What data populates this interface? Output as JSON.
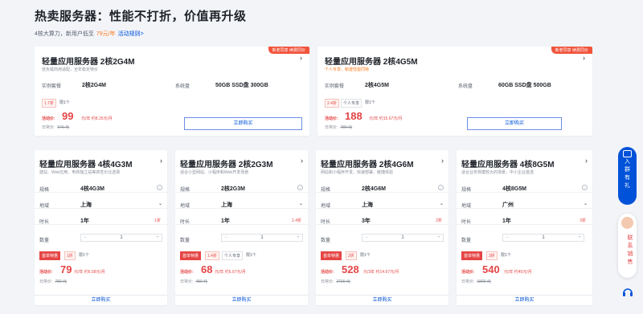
{
  "header": {
    "title": "热卖服务器：性能不打折，价值再升级",
    "sub_prefix": "4核大算力，新用户低至",
    "sub_price": "79元/年",
    "sub_link": "活动规则>"
  },
  "top_cards": [
    {
      "tag": "新老同享 续费同价",
      "title": "轻量应用服务器 2核2G4M",
      "desc": "低负载商用适配，全年稳定特价",
      "spec_label": "实例套餐",
      "spec_value": "2核2G4M",
      "disk_label": "系统盘",
      "disk_value": "50GB SSD盘 300GB",
      "disc": "1.7折",
      "qty": "限1个",
      "price_label": "活动价:",
      "price": "99",
      "unit": "元/年 约8.25元/月",
      "orig_label": "日常价:",
      "orig": "576 元",
      "buy": "立即购买"
    },
    {
      "tag": "新老同享 续费同价",
      "title": "轻量应用服务器 2核4G5M",
      "desc": "个人专享，新建性能同特",
      "spec_label": "实例套餐",
      "spec_value": "2核4G5M",
      "disk_label": "系统盘",
      "disk_value": "60GB SSD盘 500GB",
      "disc": "2.4折",
      "extra": "个人专享",
      "qty": "限1个",
      "price_label": "活动价:",
      "price": "188",
      "unit": "元/年 约15.67元/月",
      "orig_label": "日常价:",
      "orig": "780 元",
      "buy": "立即购买"
    }
  ],
  "bottom_cards": [
    {
      "title": "轻量应用服务器 4核4G3M",
      "desc": "建站、Web应用、电商独立站等高性价比选择",
      "spec_label": "规格",
      "spec": "4核4G3M",
      "region_label": "地域",
      "region": "上海",
      "dur_label": "时长",
      "dur": "1年",
      "dur_disc": "1折",
      "qty_label": "数量",
      "qty": "1",
      "badge": "首单特惠",
      "disc": "1折",
      "limit": "限1个",
      "price_label": "活动价:",
      "price": "79",
      "unit": "元/年 约6.58元/月",
      "orig_label": "日常价:",
      "orig": "780 元",
      "buy": "立即购买"
    },
    {
      "title": "轻量应用服务器 2核2G3M",
      "desc": "适合小型网站、小程序和Web开发场景",
      "spec_label": "规格",
      "spec": "2核2G3M",
      "region_label": "地域",
      "region": "上海",
      "dur_label": "时长",
      "dur": "1年",
      "dur_disc": "1.4折",
      "qty_label": "数量",
      "qty": "1",
      "badge": "首单特惠",
      "disc": "1.4折",
      "extra": "个人专享",
      "limit": "限1个",
      "price_label": "活动价:",
      "price": "68",
      "unit": "元/年 约5.67元/月",
      "orig_label": "日常价:",
      "orig": "480 元",
      "buy": "立即购买"
    },
    {
      "title": "轻量应用服务器 2核4G6M",
      "desc": "网站和小程序开发、快速部署、敏捷体验",
      "spec_label": "规格",
      "spec": "2核4G6M",
      "region_label": "地域",
      "region": "上海",
      "dur_label": "时长",
      "dur": "3年",
      "dur_disc": "2折",
      "qty_label": "数量",
      "qty": "1",
      "badge": "首单特惠",
      "disc": "2折",
      "limit": "限1个",
      "price_label": "活动价:",
      "price": "528",
      "unit": "元/3年 约14.67元/月",
      "orig_label": "日常价:",
      "orig": "2700 元",
      "buy": "立即购买"
    },
    {
      "title": "轻量应用服务器 4核8G5M",
      "desc": "适合业务规模较大的场景，中小企业首选",
      "spec_label": "规格",
      "spec": "4核8G5M",
      "region_label": "地域",
      "region": "广州",
      "dur_label": "时长",
      "dur": "1年",
      "dur_disc": "3折",
      "qty_label": "数量",
      "qty": "1",
      "badge": "首单特惠",
      "disc": "3折",
      "limit": "限1个",
      "price_label": "活动价:",
      "price": "540",
      "unit": "元/年 约45元/月",
      "orig_label": "日常价:",
      "orig": "1800 元",
      "buy": "立即购买"
    }
  ],
  "side": {
    "join": "入群有礼",
    "contact": "联系销售"
  },
  "colors": {
    "accent": "#0052d9",
    "price": "#e54545",
    "tag": "#f1533b"
  }
}
